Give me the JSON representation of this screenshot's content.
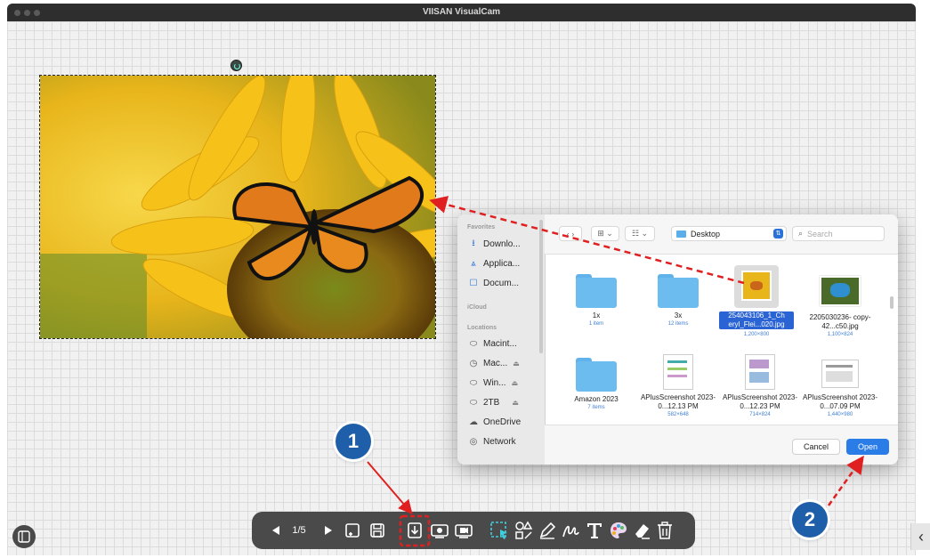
{
  "window": {
    "title": "VIISAN VisualCam"
  },
  "dialog": {
    "sidebar": {
      "favorites_label": "Favorites",
      "icloud_label": "iCloud",
      "locations_label": "Locations",
      "favorites": [
        {
          "label": "Downlo...",
          "icon": "download-icon"
        },
        {
          "label": "Applica...",
          "icon": "applications-icon"
        },
        {
          "label": "Docum...",
          "icon": "document-icon"
        }
      ],
      "locations": [
        {
          "label": "Macint...",
          "icon": "drive-icon"
        },
        {
          "label": "Mac...",
          "icon": "clock-icon",
          "eject": "⏏"
        },
        {
          "label": "Win...",
          "icon": "drive-icon",
          "eject": "⏏"
        },
        {
          "label": "2TB",
          "icon": "drive-icon",
          "eject": "⏏"
        },
        {
          "label": "OneDrive",
          "icon": "cloud-icon"
        },
        {
          "label": "Network",
          "icon": "network-icon"
        }
      ]
    },
    "toolbar": {
      "location": "Desktop",
      "search_placeholder": "Search"
    },
    "files": [
      {
        "name": "1x",
        "sub": "1 item",
        "kind": "folder"
      },
      {
        "name": "3x",
        "sub": "12 items",
        "kind": "folder"
      },
      {
        "name": "254043106_1_Ch eryl_Flei...020.jpg",
        "sub": "1,200×800",
        "kind": "image-sunflower",
        "selected": true
      },
      {
        "name": "2205030236- copy-42...c50.jpg",
        "sub": "1,100×824",
        "kind": "image-butterfly"
      },
      {
        "name": "Amazon 2023",
        "sub": "7 items",
        "kind": "folder"
      },
      {
        "name": "APlusScreenshot 2023-0...12.13 PM",
        "sub": "582×648",
        "kind": "screenshot"
      },
      {
        "name": "APlusScreenshot 2023-0...12.23 PM",
        "sub": "714×824",
        "kind": "screenshot"
      },
      {
        "name": "APlusScreenshot 2023-0...07.09 PM",
        "sub": "1,440×980",
        "kind": "screenshot"
      }
    ],
    "cancel_label": "Cancel",
    "open_label": "Open"
  },
  "bottom_toolbar": {
    "page_indicator": "1/5",
    "tools": [
      "prev-page-icon",
      "next-page-icon",
      "new-page-icon",
      "save-icon",
      "import-icon",
      "snapshot-icon",
      "record-icon",
      "select-icon",
      "shapes-icon",
      "pen-icon",
      "signature-icon",
      "text-icon",
      "color-palette-icon",
      "eraser-icon",
      "delete-icon"
    ]
  },
  "annotations": {
    "step1": "1",
    "step2": "2"
  },
  "colors": {
    "accent": "#2a7ce6",
    "callout_badge": "#1f5ea8",
    "annotation_red": "#e02020",
    "toolbar_bg": "#4a4a4a"
  }
}
